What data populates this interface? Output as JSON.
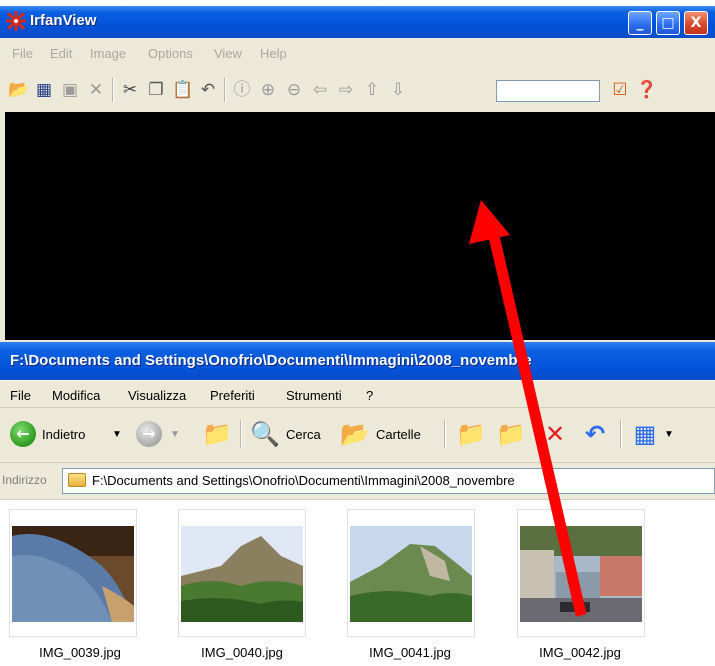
{
  "irfanview": {
    "title": "IrfanView",
    "menu": [
      "File",
      "Edit",
      "Image",
      "Options",
      "View",
      "Help"
    ],
    "window_buttons": {
      "minimize": "_",
      "maximize": "□",
      "close": "X"
    },
    "search_value": ""
  },
  "explorer": {
    "title": "F:\\Documents and Settings\\Onofrio\\Documenti\\Immagini\\2008_novembre",
    "menu": [
      "File",
      "Modifica",
      "Visualizza",
      "Preferiti",
      "Strumenti",
      "?"
    ],
    "toolbar": {
      "back": "Indietro",
      "search": "Cerca",
      "folders": "Cartelle"
    },
    "address": {
      "label": "Indirizzo",
      "value": "F:\\Documents and Settings\\Onofrio\\Documenti\\Immagini\\2008_novembre"
    },
    "files": [
      {
        "name": "IMG_0039.jpg"
      },
      {
        "name": "IMG_0040.jpg"
      },
      {
        "name": "IMG_0041.jpg"
      },
      {
        "name": "IMG_0042.jpg"
      }
    ]
  },
  "colors": {
    "titlebar": "#0353d8",
    "canvas": "#000000",
    "arrow": "#ff0000",
    "chrome": "#ece9d8"
  }
}
